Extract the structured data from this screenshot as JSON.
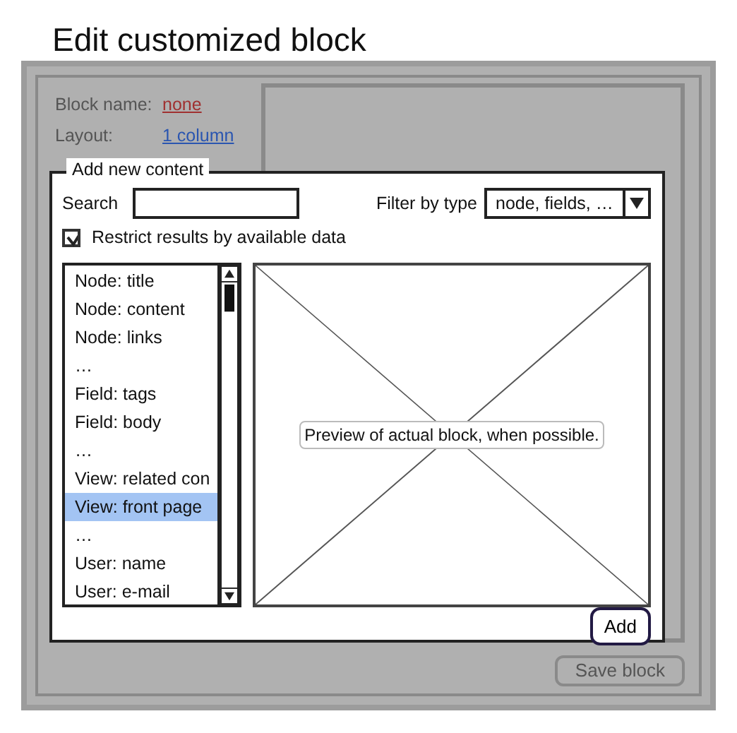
{
  "page_title": "Edit customized block",
  "background_form": {
    "block_name_label": "Block name:",
    "block_name_value": "none",
    "layout_label": "Layout:",
    "layout_value": "1 column",
    "save_button": "Save block"
  },
  "dialog": {
    "legend": "Add new content",
    "search": {
      "label": "Search"
    },
    "filter": {
      "label": "Filter by type",
      "value": "node, fields, …"
    },
    "restrict": {
      "label": "Restrict results by available data",
      "checked": true
    },
    "items": [
      {
        "label": "Node: title",
        "selected": false
      },
      {
        "label": "Node: content",
        "selected": false
      },
      {
        "label": "Node: links",
        "selected": false
      },
      {
        "label": "…",
        "selected": false
      },
      {
        "label": "Field: tags",
        "selected": false
      },
      {
        "label": "Field: body",
        "selected": false
      },
      {
        "label": "…",
        "selected": false
      },
      {
        "label": "View: related con",
        "selected": false
      },
      {
        "label": "View: front page",
        "selected": true
      },
      {
        "label": "…",
        "selected": false
      },
      {
        "label": "User: name",
        "selected": false
      },
      {
        "label": "User: e-mail",
        "selected": false
      }
    ],
    "preview_label": "Preview of actual block, when possible.",
    "add_button": "Add"
  }
}
